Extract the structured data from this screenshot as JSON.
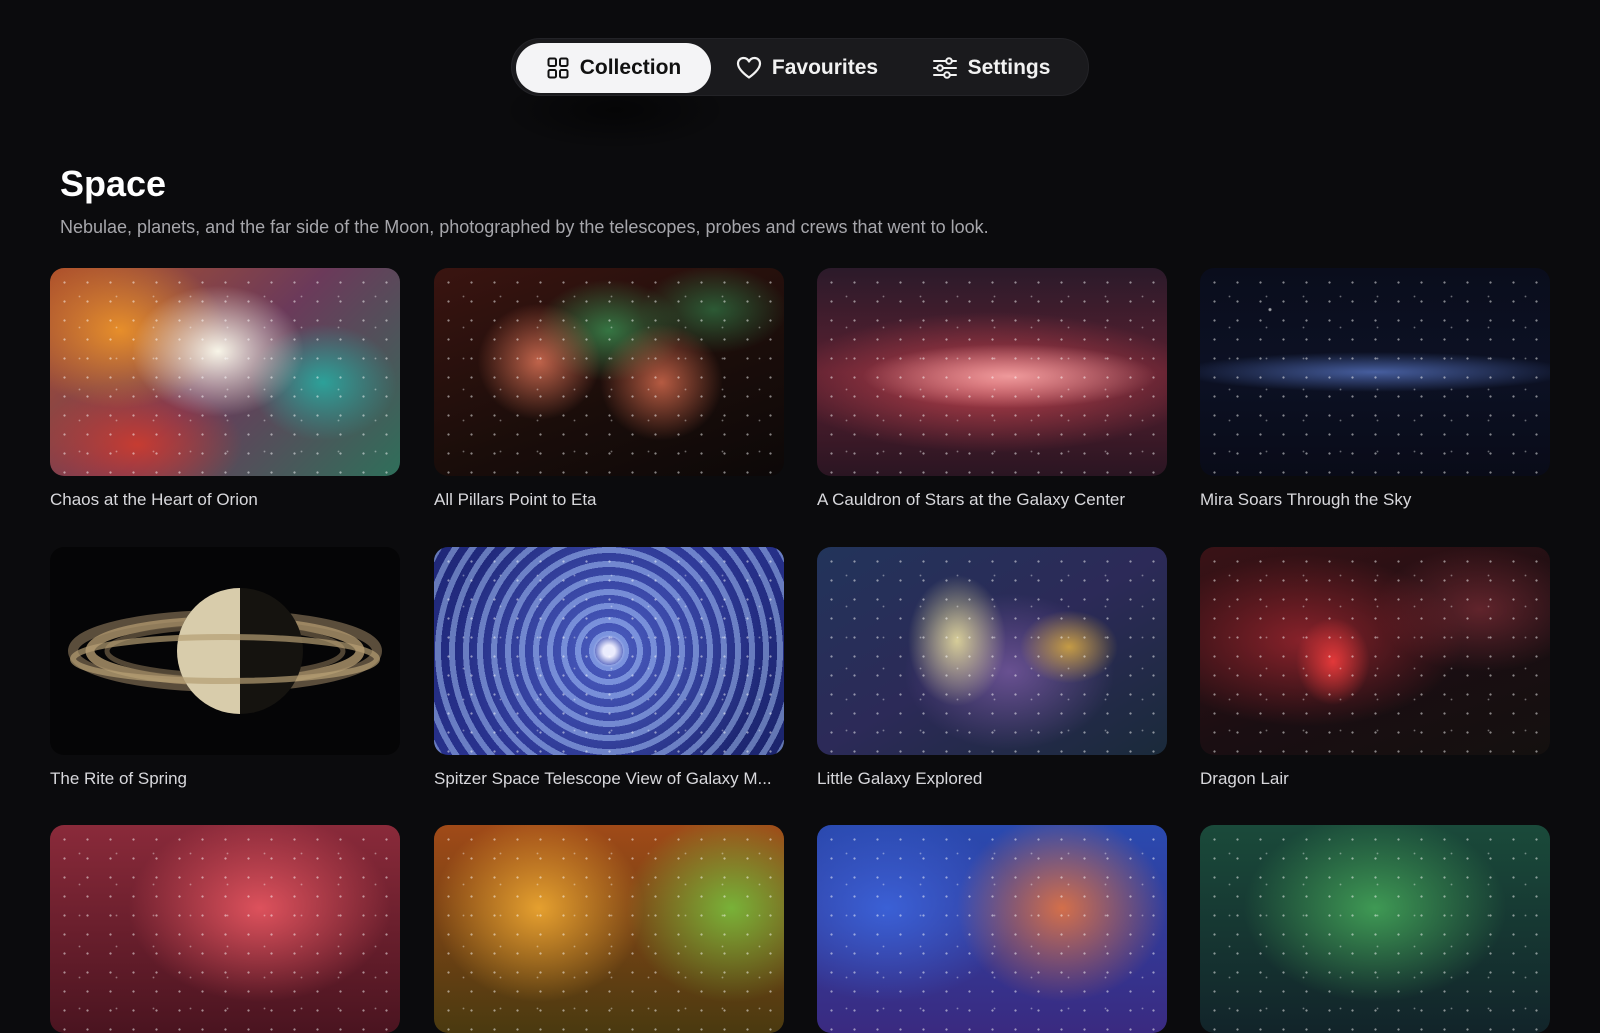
{
  "nav": {
    "tabs": [
      {
        "label": "Collection",
        "icon": "grid-icon",
        "active": true
      },
      {
        "label": "Favourites",
        "icon": "heart-icon",
        "active": false
      },
      {
        "label": "Settings",
        "icon": "sliders-icon",
        "active": false
      }
    ]
  },
  "section": {
    "title": "Space",
    "description": "Nebulae, planets, and the far side of the Moon, photographed by the telescopes, probes and crews that went to look."
  },
  "items": [
    {
      "title": "Chaos at the Heart of Orion"
    },
    {
      "title": "All Pillars Point to Eta"
    },
    {
      "title": "A Cauldron of Stars at the Galaxy Center"
    },
    {
      "title": "Mira Soars Through the Sky"
    },
    {
      "title": "The Rite of Spring"
    },
    {
      "title": "Spitzer Space Telescope View of Galaxy M..."
    },
    {
      "title": "Little Galaxy Explored"
    },
    {
      "title": "Dragon Lair"
    }
  ],
  "colors": {
    "background": "#0b0b0d",
    "nav_bg": "#1a1a1d",
    "active_tab_bg": "#f4f4f6",
    "caption": "#d8d8dc",
    "description": "#a6a6ab"
  }
}
